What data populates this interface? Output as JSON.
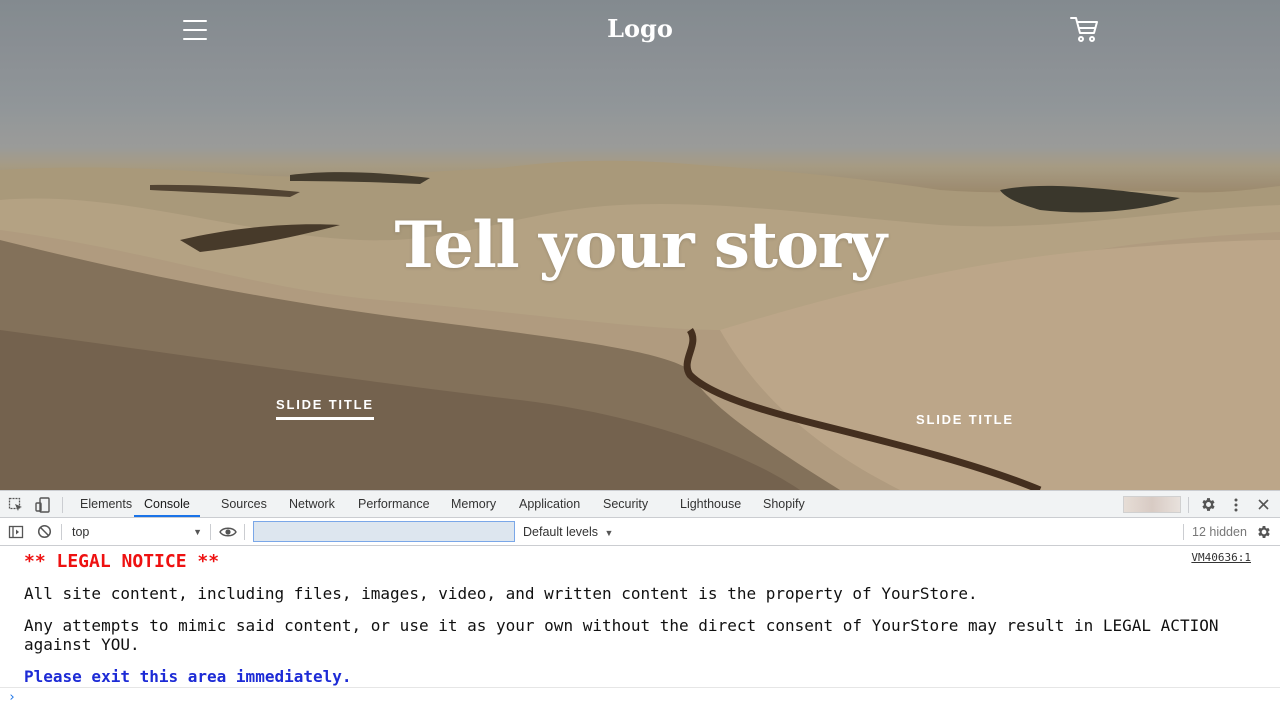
{
  "hero": {
    "logo": "Logo",
    "title": "Tell your story",
    "slides": [
      "SLIDE TITLE",
      "SLIDE TITLE"
    ],
    "icons": {
      "menu": "hamburger-menu-icon",
      "cart": "shopping-cart-icon"
    }
  },
  "devtools": {
    "tabs": [
      "Elements",
      "Console",
      "Sources",
      "Network",
      "Performance",
      "Memory",
      "Application",
      "Security",
      "Lighthouse",
      "Shopify"
    ],
    "active_tab": "Console",
    "toolbar": {
      "context": "top",
      "filter_value": "",
      "levels": "Default levels",
      "hidden": "12 hidden"
    },
    "console": {
      "source": "VM40636:1",
      "title": "** LEGAL NOTICE **",
      "line1": "All site content, including files, images, video, and written content is the property of YourStore.",
      "line2": "Any attempts to mimic said content, or use it as your own without the direct consent of YourStore may result in LEGAL ACTION against YOU.",
      "line3": "Please exit this area immediately.",
      "prompt": "›"
    },
    "colors": {
      "accent": "#1a73e8",
      "notice_red": "#e11111",
      "notice_blue": "#1d2bd6"
    }
  }
}
